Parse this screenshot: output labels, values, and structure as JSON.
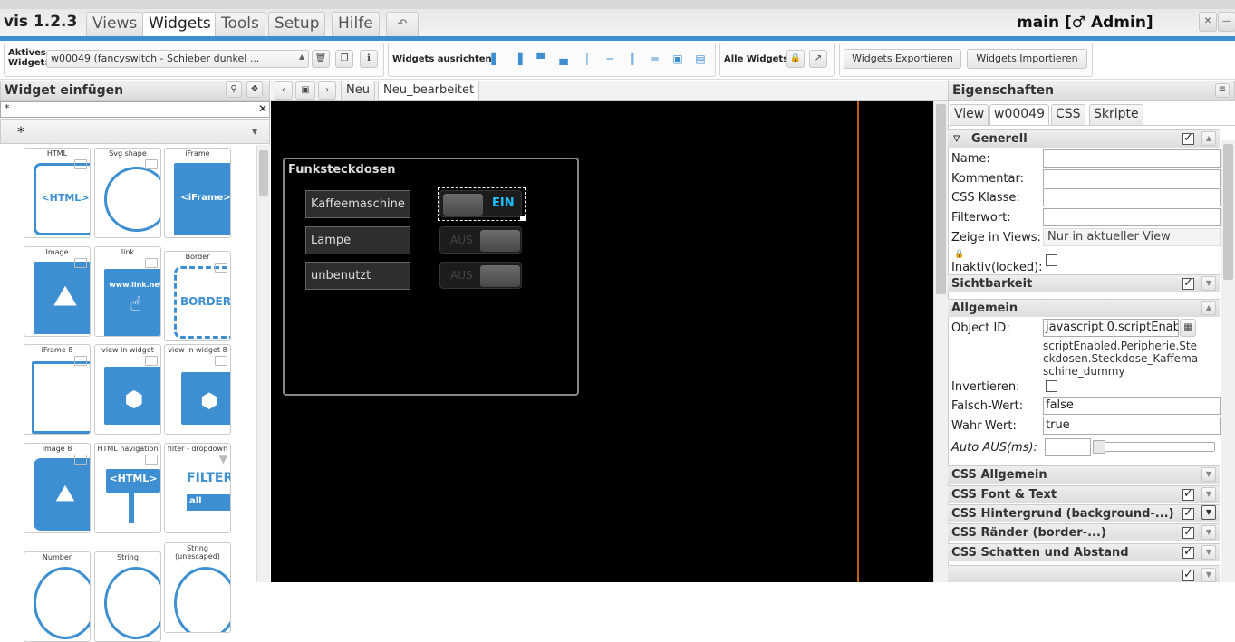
{
  "app": {
    "name": "vis 1.2.3",
    "view_user": "main [♂ Admin]"
  },
  "menu": [
    "Views",
    "Widgets",
    "Tools",
    "Setup",
    "Hilfe"
  ],
  "toolbar": {
    "active_widget_label": "Aktives Widget:",
    "active_widget_value": "w00049 (fancyswitch - Schieber dunkel ...",
    "align_label": "Widgets ausrichten:",
    "all_widgets_label": "Alle Widgets:",
    "export_label": "Widgets Exportieren",
    "import_label": "Widgets Importieren"
  },
  "left": {
    "title": "Widget einfügen",
    "filter_value": "*",
    "set_value": "*",
    "widgets": [
      {
        "name": "HTML",
        "label": "<HTML>"
      },
      {
        "name": "Svg shape",
        "label": ""
      },
      {
        "name": "iFrame",
        "label": "<iFrame>"
      },
      {
        "name": "Image",
        "label": ""
      },
      {
        "name": "link",
        "label": "www.link.net"
      },
      {
        "name": "Border",
        "label": "BORDER"
      },
      {
        "name": "iFrame 8",
        "label": ""
      },
      {
        "name": "view in widget",
        "label": ""
      },
      {
        "name": "view in widget 8",
        "label": ""
      },
      {
        "name": "Image 8",
        "label": ""
      },
      {
        "name": "HTML navigation",
        "label": "<HTML>"
      },
      {
        "name": "filter - dropdown",
        "label": "FILTER"
      },
      {
        "name": "Number",
        "label": ""
      },
      {
        "name": "String",
        "label": ""
      },
      {
        "name": "String (unescaped)",
        "label": ""
      }
    ]
  },
  "center": {
    "tabs": [
      "Neu",
      "Neu_bearbeitet"
    ],
    "widget_title": "Funksteckdosen",
    "devices": [
      {
        "name": "Kaffeemaschine",
        "state": "EIN"
      },
      {
        "name": "Lampe",
        "state": "AUS"
      },
      {
        "name": "unbenutzt",
        "state": "AUS"
      }
    ]
  },
  "right": {
    "title": "Eigenschaften",
    "tabs": [
      "View",
      "w00049",
      "CSS",
      "Skripte"
    ],
    "sections": {
      "generell": "Generell",
      "sichtbarkeit": "Sichtbarkeit",
      "allgemein": "Allgemein",
      "css_allgemein": "CSS Allgemein",
      "css_font": "CSS Font & Text",
      "css_hintergrund": "CSS Hintergrund (background-...)",
      "css_raender": "CSS Ränder (border-...)",
      "css_schatten": "CSS Schatten und Abstand"
    },
    "labels": {
      "name": "Name:",
      "kommentar": "Kommentar:",
      "css_klasse": "CSS Klasse:",
      "filterwort": "Filterwort:",
      "zeige": "Zeige in Views:",
      "inaktiv": "Inaktiv(locked):",
      "object_id": "Object ID:",
      "invertieren": "Invertieren:",
      "falsch": "Falsch-Wert:",
      "wahr": "Wahr-Wert:",
      "auto_aus": "Auto AUS(ms):"
    },
    "values": {
      "zeige": "Nur in aktueller View",
      "object_id": "javascript.0.scriptEnab",
      "object_id_full": "scriptEnabled.Peripherie.Steckdosen.Steckdose_Kaffemaschine_dummy",
      "falsch": "false",
      "wahr": "true"
    }
  }
}
